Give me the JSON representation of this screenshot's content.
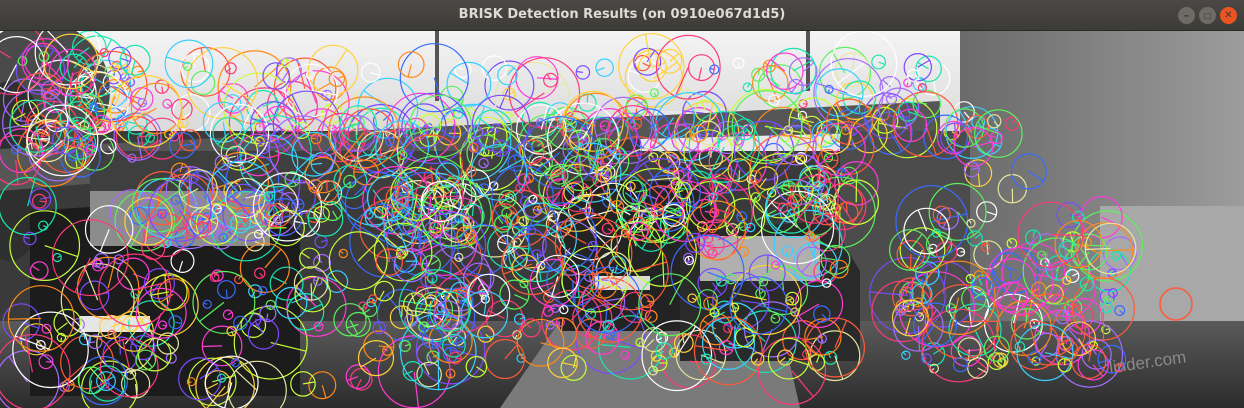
{
  "window": {
    "title": "BRISK Detection Results (on 0910e067d1d5)",
    "minimize_symbol": "–",
    "maximize_symbol": "□",
    "close_symbol": "✕"
  },
  "image": {
    "type": "grayscale street scene (cars ahead under a bridge, truck on right) with BRISK keypoints drawn as colored circles",
    "watermark_text": "linder.com",
    "keypoint_colors": [
      "#ff3bd6",
      "#5cf05c",
      "#3ad0ff",
      "#ffd23a",
      "#ff5a3a",
      "#a46bff",
      "#ffffff",
      "#3a6bff",
      "#ff8a1a",
      "#19e6b0",
      "#c8ff3a",
      "#ff3a7a",
      "#7a4bff",
      "#e6e6a0"
    ]
  }
}
